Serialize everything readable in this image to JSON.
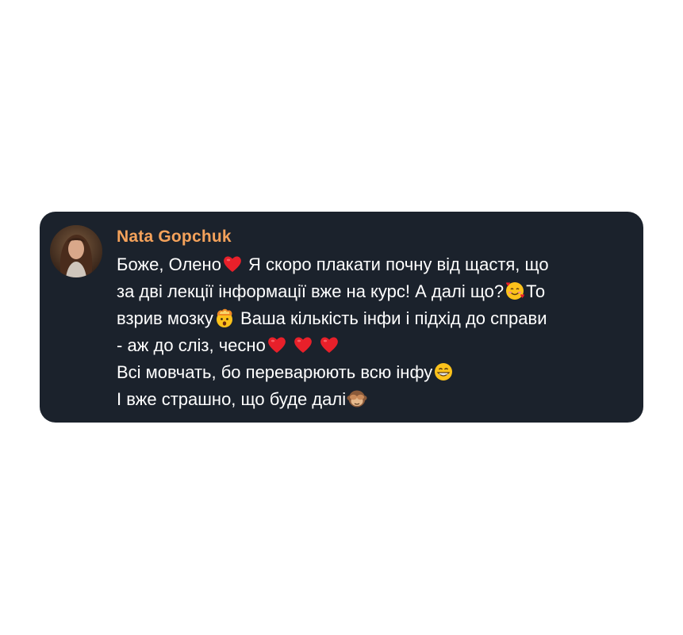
{
  "message": {
    "author": "Nata Gopchuk",
    "lines": [
      {
        "segments": [
          "Боже, Олено",
          " Я скоро плакати почну від щастя, що"
        ]
      },
      {
        "segments": [
          "за дві лекції інформації вже на курс! А далі що?",
          "То"
        ]
      },
      {
        "segments": [
          "взрив мозку",
          " Ваша кількість інфи і підхід до справи"
        ]
      },
      {
        "segments": [
          "- аж до сліз, чесно"
        ]
      },
      {
        "segments": [
          "Всі мовчать, бо переварюють всю інфу"
        ]
      },
      {
        "segments": [
          "І вже страшно, що буде далі"
        ]
      }
    ],
    "emojis": {
      "heart": "red-heart-icon",
      "smiling_hearts": "smiling-face-with-hearts-icon",
      "exploding_head": "exploding-head-icon",
      "grin": "grinning-face-icon",
      "see_no_evil": "see-no-evil-monkey-icon"
    }
  },
  "colors": {
    "card_background": "#1b222c",
    "author": "#f4a25b",
    "text": "#ffffff",
    "page_background": "#ffffff"
  }
}
